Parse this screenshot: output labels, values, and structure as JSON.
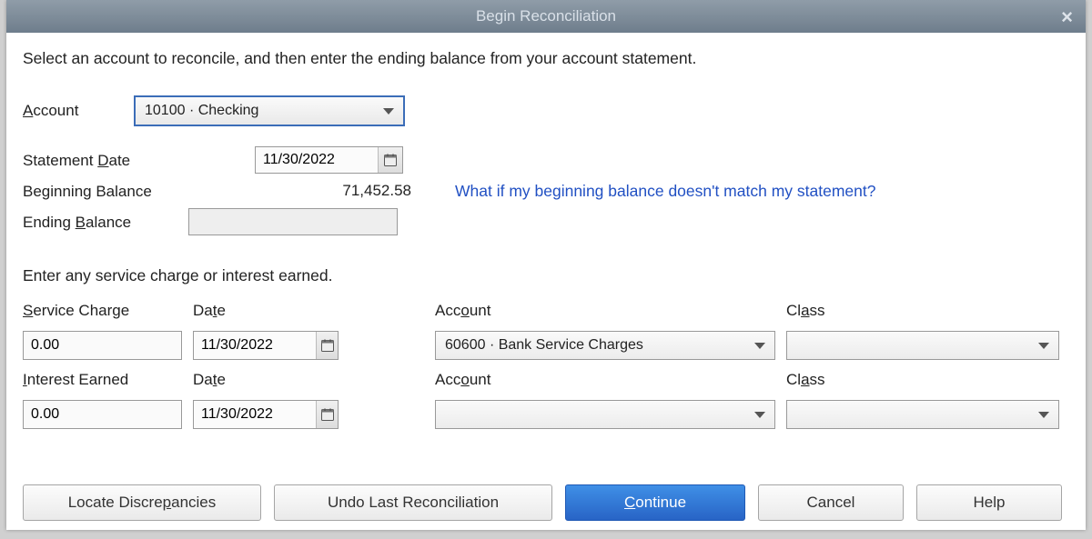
{
  "title": "Begin Reconciliation",
  "instruction": "Select an account to reconcile, and then enter the ending balance from your account statement.",
  "labels": {
    "account": "ccount",
    "statement_date_pre": "Statement ",
    "statement_date_post": "ate",
    "beginning_balance": "Beginning Balance",
    "ending_pre": "Ending ",
    "ending_post": "alance",
    "sc_section": "Enter any service charge or interest earned.",
    "service_pre": "ervice Charge",
    "interest_pre": "nterest Earned",
    "date_pre": "Da",
    "date_post": "e",
    "acc_pre": "Acc",
    "acc_mid": "o",
    "acc_post": "unt",
    "class_pre": "Cl",
    "class_post": "ss"
  },
  "account": {
    "selected": "10100 · Checking"
  },
  "statement_date": "11/30/2022",
  "beginning_balance": "71,452.58",
  "ending_balance": "",
  "help_link": "What if my beginning balance doesn't match my statement?",
  "service_charge": {
    "amount": "0.00",
    "date": "11/30/2022",
    "account": "60600 · Bank Service Charges",
    "class": ""
  },
  "interest_earned": {
    "amount": "0.00",
    "date": "11/30/2022",
    "account": "",
    "class": ""
  },
  "buttons": {
    "locate_pre": "Locate Discre",
    "locate_post": "ancies",
    "undo": "Undo Last Reconciliation",
    "continue_post": "ontinue",
    "cancel": "Cancel",
    "help": "Help"
  }
}
